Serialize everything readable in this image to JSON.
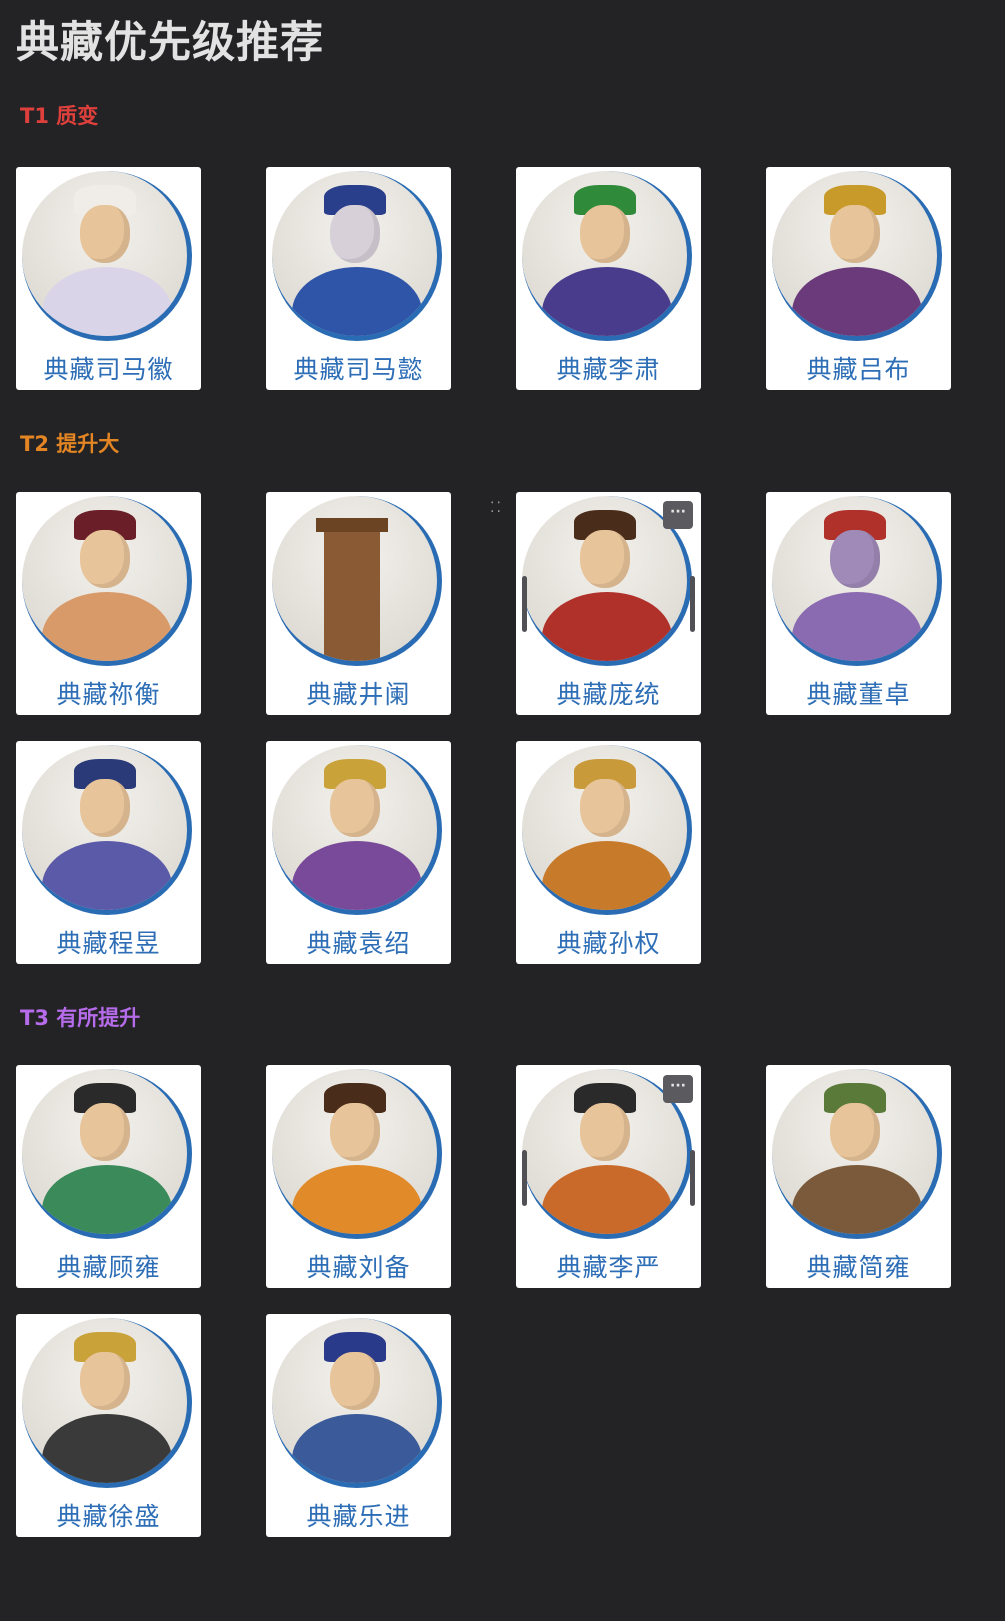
{
  "page": {
    "title": "典藏优先级推荐"
  },
  "colors": {
    "background": "#232326",
    "tier1": "#e0403c",
    "tier2": "#e38522",
    "tier3": "#b66bea",
    "card_label": "#2d6eb6",
    "portrait_ring": "#2a6cb3"
  },
  "tiers": [
    {
      "heading": "T1 质变",
      "cards": [
        {
          "label": "典藏司马徽"
        },
        {
          "label": "典藏司马懿"
        },
        {
          "label": "典藏李肃"
        },
        {
          "label": "典藏吕布"
        }
      ]
    },
    {
      "heading": "T2 提升大",
      "cards": [
        {
          "label": "典藏祢衡"
        },
        {
          "label": "典藏井阑"
        },
        {
          "label": "典藏庞统"
        },
        {
          "label": "典藏董卓"
        },
        {
          "label": "典藏程昱"
        },
        {
          "label": "典藏袁绍"
        },
        {
          "label": "典藏孙权"
        }
      ]
    },
    {
      "heading": "T3 有所提升",
      "cards": [
        {
          "label": "典藏顾雍"
        },
        {
          "label": "典藏刘备"
        },
        {
          "label": "典藏李严"
        },
        {
          "label": "典藏简雍"
        },
        {
          "label": "典藏徐盛"
        },
        {
          "label": "典藏乐进"
        }
      ]
    }
  ],
  "controls": {
    "more_icon": "ellipsis-icon",
    "more_glyph": "···",
    "drag_icon": "drag-handle-icon",
    "drag_glyph": "⁚⁚"
  }
}
